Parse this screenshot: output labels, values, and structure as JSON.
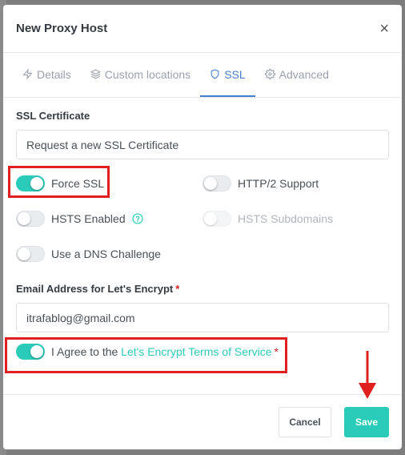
{
  "dialog": {
    "title": "New Proxy Host",
    "close_symbol": "×"
  },
  "tabs": [
    {
      "label": "Details",
      "icon": "lightning-icon",
      "active": false
    },
    {
      "label": "Custom locations",
      "icon": "layers-icon",
      "active": false
    },
    {
      "label": "SSL",
      "icon": "shield-icon",
      "active": true
    },
    {
      "label": "Advanced",
      "icon": "gear-icon",
      "active": false
    }
  ],
  "ssl": {
    "certificate_label": "SSL Certificate",
    "certificate_value": "Request a new SSL Certificate",
    "toggles": {
      "force_ssl": {
        "label": "Force SSL",
        "on": true
      },
      "http2": {
        "label": "HTTP/2 Support",
        "on": false
      },
      "hsts": {
        "label": "HSTS Enabled",
        "on": false
      },
      "hsts_subdomains": {
        "label": "HSTS Subdomains",
        "on": false,
        "disabled": true
      },
      "dns_challenge": {
        "label": "Use a DNS Challenge",
        "on": false
      }
    },
    "email_label": "Email Address for Let's Encrypt",
    "email_required": "*",
    "email_value": "itrafablog@gmail.com",
    "agree_prefix": "I Agree to the ",
    "agree_link": "Let's Encrypt Terms of Service",
    "agree_required": "*",
    "agree_on": true
  },
  "footer": {
    "cancel_label": "Cancel",
    "save_label": "Save"
  },
  "colors": {
    "accent": "#2bcbba",
    "active_tab": "#467fcf",
    "annotation": "#e0201f"
  }
}
